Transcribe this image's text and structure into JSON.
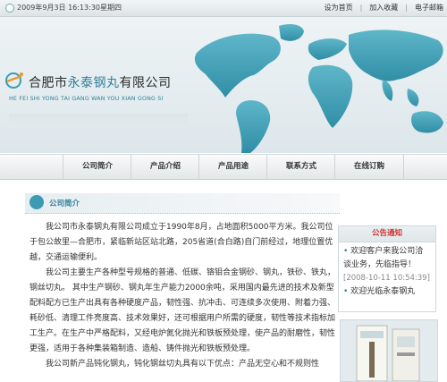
{
  "topbar": {
    "datetime": "2009年9月3日  16:13:30星期四",
    "links": [
      "设为首页",
      "加入收藏",
      "电子邮箱"
    ]
  },
  "brand": {
    "name_cn_prefix": "合肥市",
    "name_cn_highlight": "永泰钢丸",
    "name_cn_suffix": "有限公司",
    "name_en": "HE FEI SHI YONG TAI GANG WAN YOU XIAN GONG SI",
    "accent_color": "#2f7f9a"
  },
  "nav": {
    "items": [
      "公司简介",
      "产品介绍",
      "产品用途",
      "联系方式",
      "在线订购"
    ]
  },
  "section": {
    "title": "公司简介",
    "paragraphs": [
      "我公司市永泰钢丸有限公司成立于1990年8月，占地面积5000平方米。我公司位于包公故里—合肥市，紧临新站区站北路，205省道(合白路)自门前经过，地理位置优越，交通运输便利。",
      "我公司主要生产各种型号规格的普通、低碳、铬钼合金钢砂、钢丸，铁砂、铁丸，钢丝切丸。 其中生产钢砂、钢丸年生产能力2000余吨，采用国内最先进的技术及新型配料配方已生产出具有各种硬度产品，韧性强、抗冲击、可连续多次使用、附着力强、耗砂低、清理工件亮度高、技术效果好，还可根据用户所需的硬度，韧性等技术指标加工生产。在生产中严格配料，又经电炉氮化抛光和铁板预处理，使产品的耐磨性，韧性更强，适用于各种集装箱制造、造船、铸件抛光和铁板预处理。",
      "我公司新产品钝化钢丸，钝化钢丝切丸具有以下优点：产品无空心和不规则性"
    ]
  },
  "notice": {
    "title": "公告通知",
    "items": [
      {
        "text": "欢迎客户来我公司洽谈业务，先临指导！",
        "time": "[2008-10-11 10:54:39]"
      },
      {
        "text": "欢迎光临永泰钢丸",
        "time": ""
      }
    ]
  },
  "icons": {
    "clock": "clock-icon",
    "logo": "company-logo-icon",
    "section": "section-bullet-icon"
  }
}
